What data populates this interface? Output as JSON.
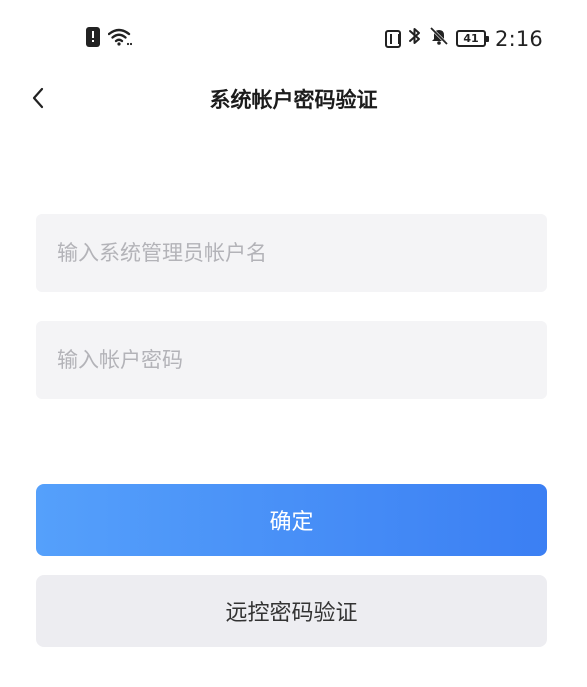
{
  "status_bar": {
    "battery_level": "41",
    "time": "2:16"
  },
  "header": {
    "title": "系统帐户密码验证"
  },
  "form": {
    "username_placeholder": "输入系统管理员帐户名",
    "username_value": "",
    "password_placeholder": "输入帐户密码",
    "password_value": ""
  },
  "actions": {
    "confirm_label": "确定",
    "remote_verify_label": "远控密码验证"
  },
  "colors": {
    "confirm_gradient_start": "#55a0fb",
    "confirm_gradient_end": "#3b7ff3",
    "field_background": "#f4f4f6",
    "secondary_button_background": "#ededf1"
  }
}
